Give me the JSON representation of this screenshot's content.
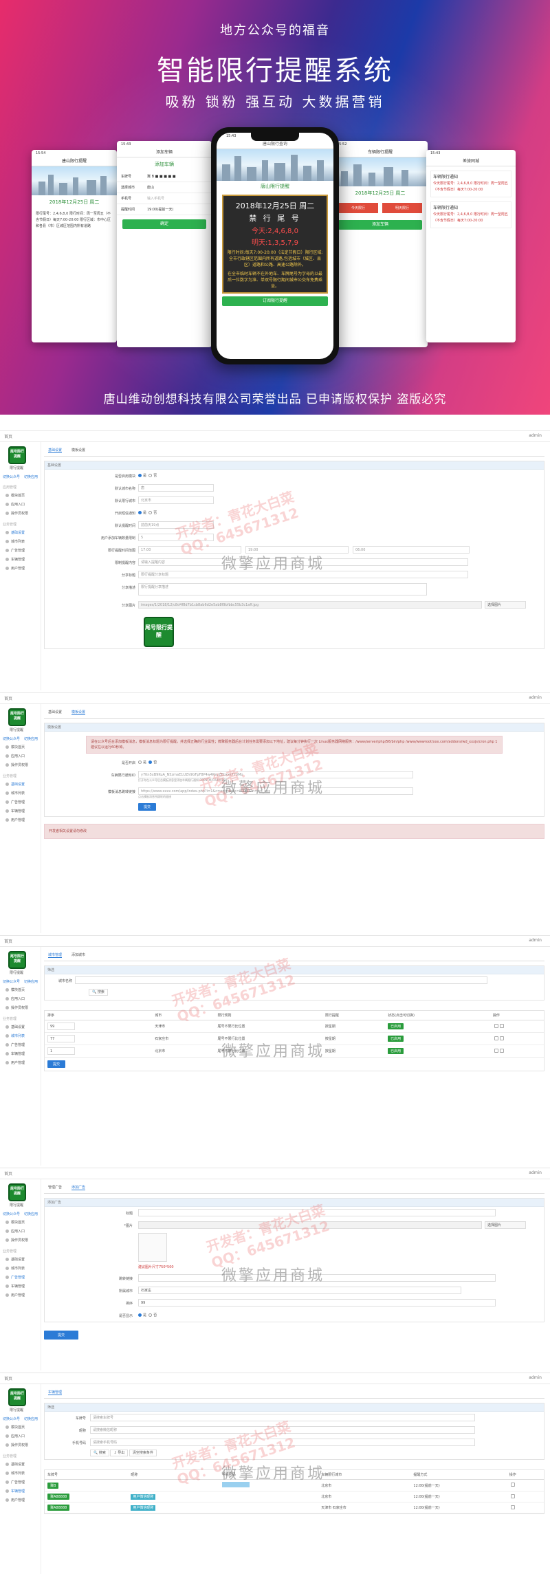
{
  "banner": {
    "subtitle": "地方公众号的福音",
    "title": "智能限行提醒系统",
    "tags": "吸粉  锁粉  强互动  大数据营销",
    "footer": "唐山维动创想科技有限公司荣誉出品    已申请版权保护  盗版必究",
    "phones": {
      "p1_time": "15:54",
      "p1_title": "唐山限行提醒",
      "p1_date": "2018年12月25日 周二",
      "p1_text": "限行尾号：2,4,6,8,0 限行时间：周一至周五（不含节假日）每天7:00-20:00 限行区域：市中心区和各县（市）区城区范围内所有道路",
      "p2_time": "15:43",
      "p2_title": "添加车辆",
      "p2_plate_label": "车牌号",
      "p2_city_label": "选择城市",
      "p2_city": "唐山",
      "p2_phone_label": "手机号",
      "p2_phone_ph": "输入手机号",
      "p2_remind_label": "提醒时间",
      "p2_remind": "19:00(提前一天)",
      "p2_btn": "确定",
      "p3_time": "15:43",
      "p3_title": "唐山限行查询",
      "p3_link": "唐山限行提醒",
      "p3_date": "2018年12月25日 周二",
      "p3_head": "禁 行 尾 号",
      "p3_today": "今天:2,4,6,8,0",
      "p3_tomorrow": "明天:1,3,5,7,9",
      "p3_desc1": "限行时间:每天7:00-20:00（法定节假日）限行区域:全市行政辖区范围内所有道路,包括城市（城区、县区）道路和公路、高速公路除外。",
      "p3_desc2": "在全市临时车辆不在外地车、车牌尾号为字母的以最后一位数字为准、单双号限行期间城市公交车免费乘坐。",
      "p3_btn": "订阅限行提醒",
      "p4_time": "15:52",
      "p4_title": "车辆限行提醒",
      "p4_date": "2018年12月25日 周二",
      "p4_today_lbl": "今天限行",
      "p4_tomorrow_lbl": "明天限行",
      "p4_btn": "添加车辆",
      "p5_time": "15:43",
      "p5_title": "差旅同城",
      "p5_card1": "车辆限行通知",
      "p5_card2": "车辆限行通知",
      "p5_text": "今天限行尾号：2,4,6,8,0 限行时间：周一至周五（不含节假日）每天7:00-20:00"
    }
  },
  "panel_common": {
    "home": "首页",
    "admin": "admin",
    "logo_text": "尾号限行提醒",
    "logo_name": "限行提醒",
    "switch_left": "切换公众号",
    "switch_right": "切换应用",
    "section_mgmt": "应用管理",
    "items": [
      "模块首页",
      "应用入口",
      "操作员权限"
    ],
    "section_biz": "业务管理",
    "biz_items": [
      "基础设置",
      "城市列表",
      "广告管理",
      "车辆管理",
      "用户管理"
    ],
    "watermark": "微擎应用商城",
    "red_wm_1": "开发者：青花大白菜",
    "red_wm_2": "QQ：645671312"
  },
  "panel1": {
    "tabs": [
      "基础设置",
      "模板设置"
    ],
    "box_title": "基础设置",
    "rows": [
      {
        "label": "是否启用模块",
        "type": "radio",
        "a": "是",
        "b": "否"
      },
      {
        "label": "默认城市名称",
        "type": "input",
        "value": "唐"
      },
      {
        "label": "默认限行城市",
        "type": "input",
        "value": "北京市"
      },
      {
        "label": "开启短信通知",
        "type": "radio",
        "a": "是",
        "b": "否"
      },
      {
        "label": "默认提醒时间",
        "type": "input",
        "value": "前前天19点"
      },
      {
        "label": "用户添加车辆数量限制",
        "type": "input",
        "value": "5"
      },
      {
        "label": "限行提醒时间范围",
        "type": "triple",
        "a": "17:00",
        "b": "19:00",
        "c": "06:00"
      },
      {
        "label": "限制提醒内容",
        "type": "input",
        "value": "请输入提醒内容"
      },
      {
        "label": "分享标题",
        "type": "input",
        "value": "限行提醒分享标题"
      },
      {
        "label": "分享描述",
        "type": "input",
        "value": "限行提醒分享描述"
      },
      {
        "label": "分享图片",
        "type": "input",
        "value": "images/1/2018/12/c8d4f8d7b1cb8ab6d2e5ab8f9bfbbc55b3c1aff.jpg"
      }
    ],
    "choose": "选择图片",
    "logo_text": "尾号限行提醒"
  },
  "panel2": {
    "tabs": [
      "基础设置",
      "模板设置"
    ],
    "box_title": "模板设置",
    "alert": "请在公众号后台添加模板消息，模板消息标题为限行提醒，并选择正确的行业属性；微擎服务器后台计划任务需要添加以下地址，建议每分钟执行一次 Linux服务器网络服务：/www/server/php/56/bin/php /www/wwwroot/xxx.com/addons/wd_xxxjs/cron.php 1 建议在以运行60秒钟。",
    "enable_label": "是否开启",
    "enable_a": "是",
    "enable_b": "否",
    "tpl_label": "车辆限行通知ID",
    "tpl_value": "y7Kn5xB9KuA_N5zmaE1UZh9GFpF8P4w4RsvZEbxxk7Y3Mo",
    "tpl_help": "打开你在公众号后台模板消息里添加车辆限行通知 OPENTM416404808",
    "url_label": "模板消息跳转链接",
    "url_value": "https://www.xxxx.com/app/index.php?i=1&c=entry&do=index&m=wd_xxx",
    "url_help": "点击模板消息所跳转的链接",
    "submit": "提交",
    "notice": "开发者相关设置请勿修改"
  },
  "panel3": {
    "tabs": [
      "城市管理",
      "添加城市"
    ],
    "box_title": "筛选",
    "city_label": "城市名称",
    "search": "搜索",
    "headers": [
      "排序",
      "城市",
      "限行规则",
      "限行提醒",
      "状态(点击可切换)",
      "操作"
    ],
    "rows": [
      {
        "order": "99",
        "city": "天津市",
        "rule": "尾号不限行比位置",
        "remind": "按星期",
        "status": "已启用"
      },
      {
        "order": "77",
        "city": "石家庄市",
        "rule": "尾号不限行比位置",
        "remind": "按星期",
        "status": "已启用"
      },
      {
        "order": "1",
        "city": "北京市",
        "rule": "尾号不限行比位置",
        "remind": "按星期",
        "status": "已启用"
      }
    ],
    "submit": "提交"
  },
  "panel4": {
    "tabs": [
      "管理广告",
      "添加广告"
    ],
    "box_title": "添加广告",
    "title_label": "标题",
    "img_label": "*图片",
    "choose": "选择图片",
    "img_hint": "建议图片尺寸750*500",
    "link_label": "跳转链接",
    "city_label": "所属城市",
    "city_value": "石家庄",
    "sort_label": "排序",
    "sort_value": "99",
    "show_label": "是否显示",
    "show_a": "是",
    "show_b": "否",
    "submit": "提交"
  },
  "panel5": {
    "tabs": [
      "车辆管理"
    ],
    "box_title": "筛选",
    "plate_label": "车牌号",
    "plate_ph": "请搜索车牌号",
    "openid_label": "昵称",
    "openid_ph": "请搜索微信昵称",
    "phone_label": "手机号码",
    "phone_ph": "请搜索手机号码",
    "search": "搜索",
    "export": "导出",
    "clear": "清空搜索条件",
    "headers": [
      "车牌号",
      "昵称",
      "手机号码",
      "车辆限行城市",
      "提醒方式",
      "操作"
    ],
    "rows": [
      {
        "plate": "冀B",
        "nick": "",
        "phone": "",
        "city": "北京市",
        "remind": "12:00(提前一天)"
      },
      {
        "plate": "冀A88888",
        "nick": "用户微信昵称",
        "phone": "",
        "city": "北京市",
        "remind": "12:00(提前一天)"
      },
      {
        "plate": "冀A88888",
        "nick": "用户微信昵称",
        "phone": "",
        "city": "天津市 石家庄市",
        "remind": "12:00(提前一天)"
      }
    ]
  }
}
